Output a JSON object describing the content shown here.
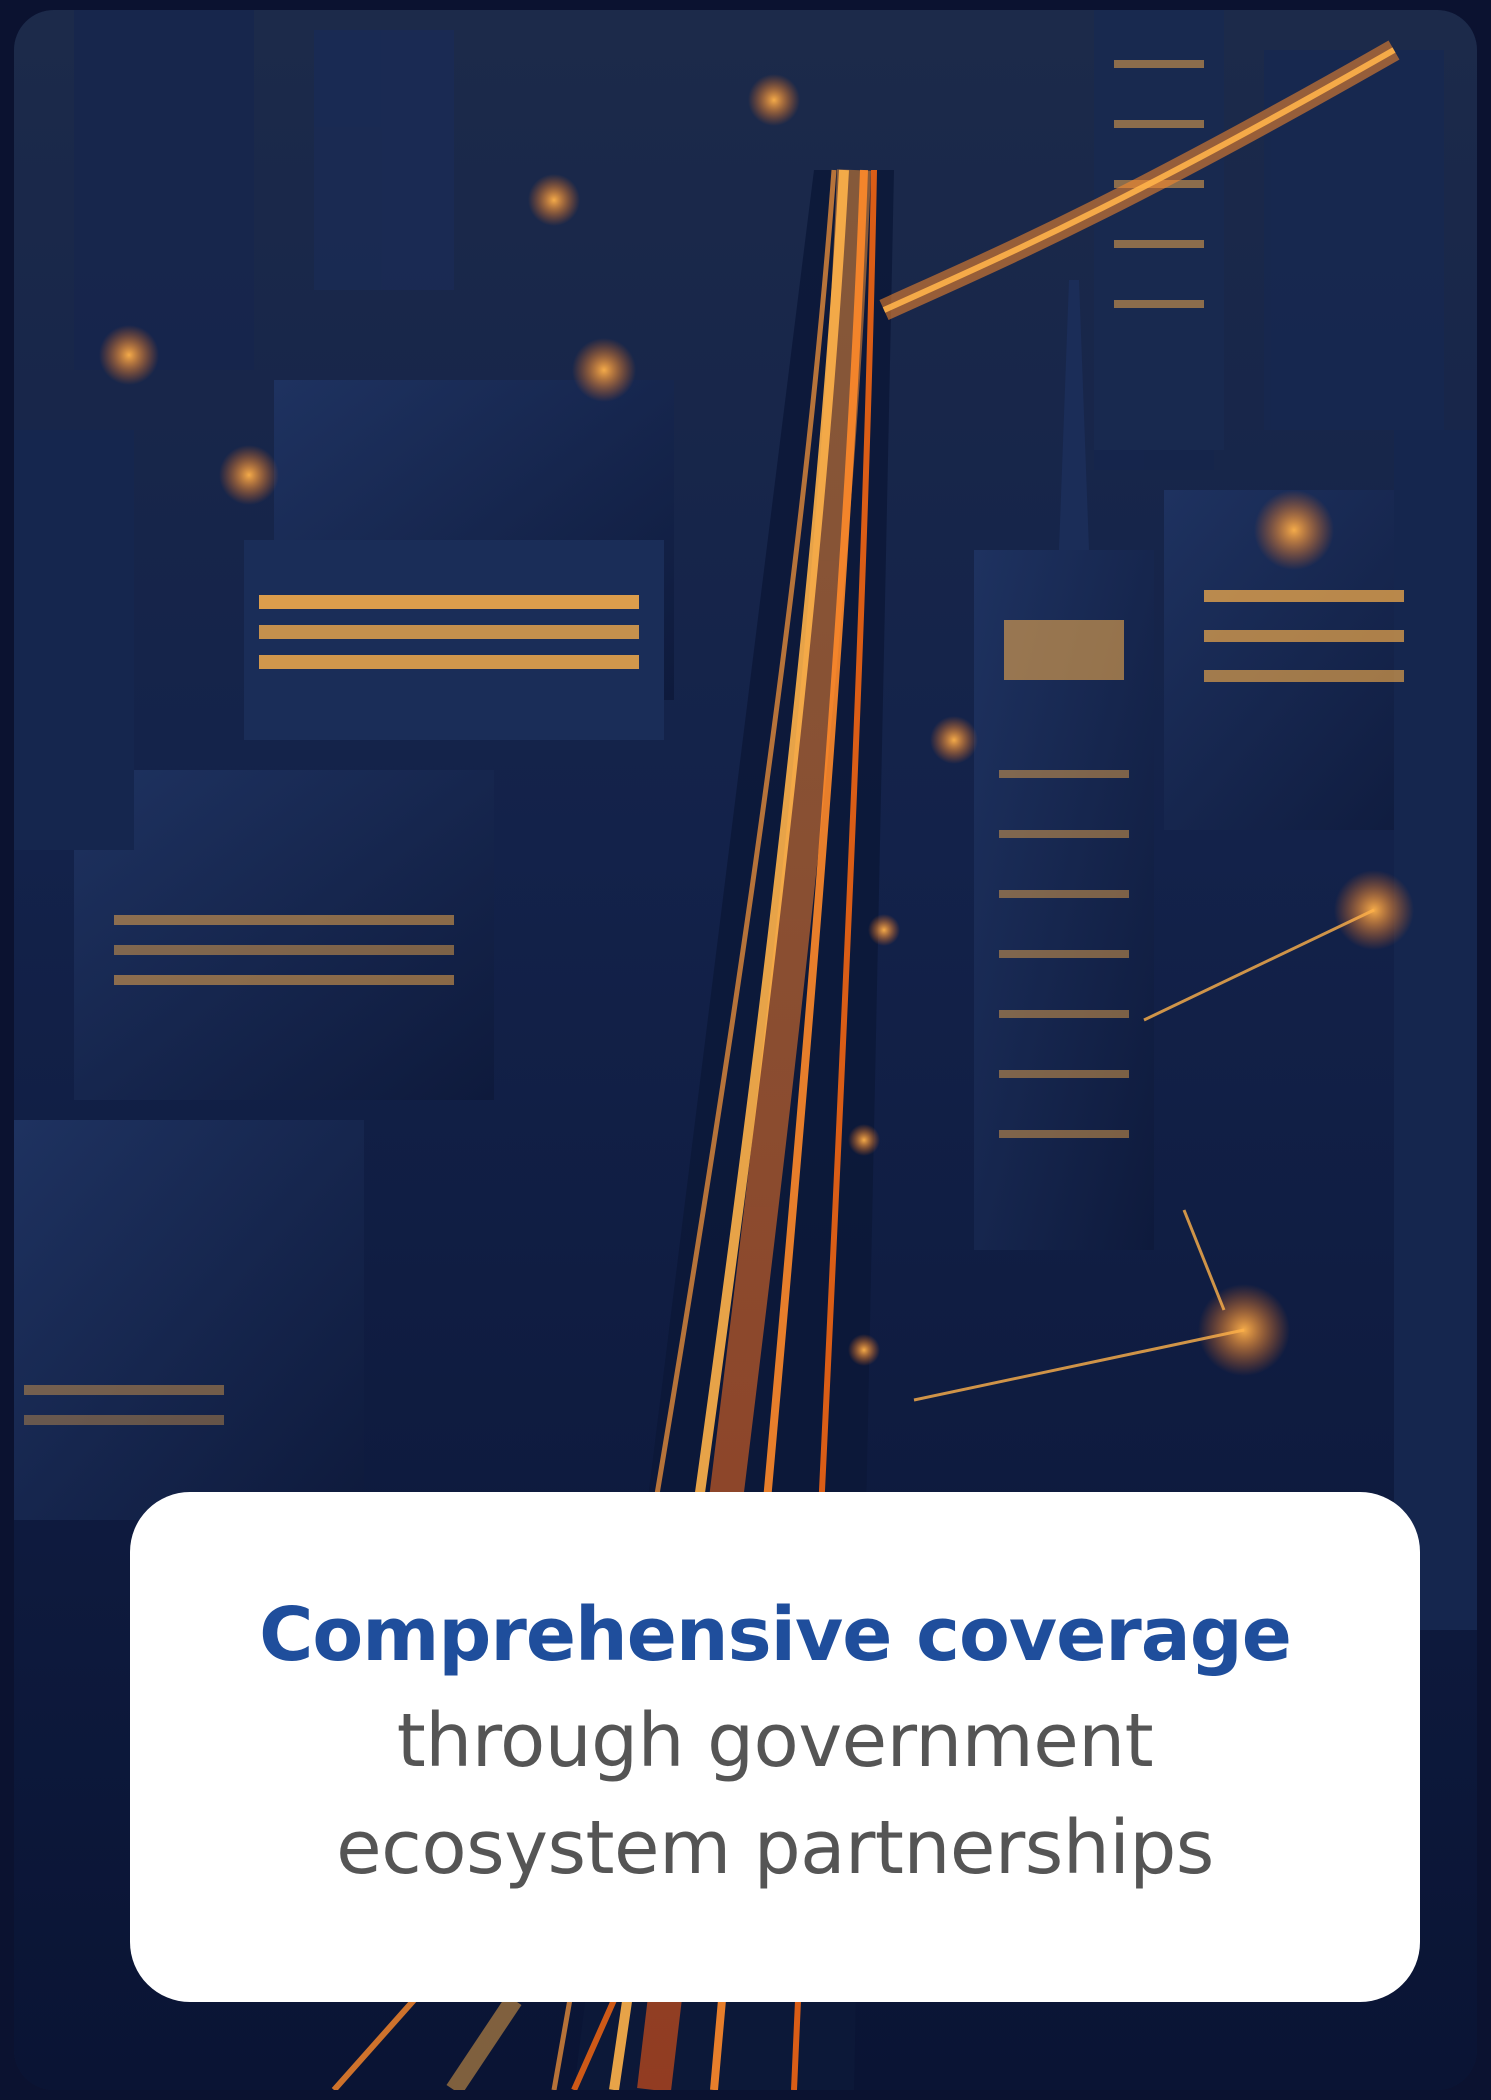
{
  "caption": {
    "headline": "Comprehensive coverage",
    "subline_1": "through government",
    "subline_2": "ecosystem partnerships"
  },
  "colors": {
    "headline": "#1f4e9c",
    "subline": "#555555",
    "card_background": "#ffffff",
    "scene_night": "#0d1a3d",
    "light_trail": "#ff7a1a"
  },
  "image": {
    "subject": "night-city-light-trails"
  }
}
